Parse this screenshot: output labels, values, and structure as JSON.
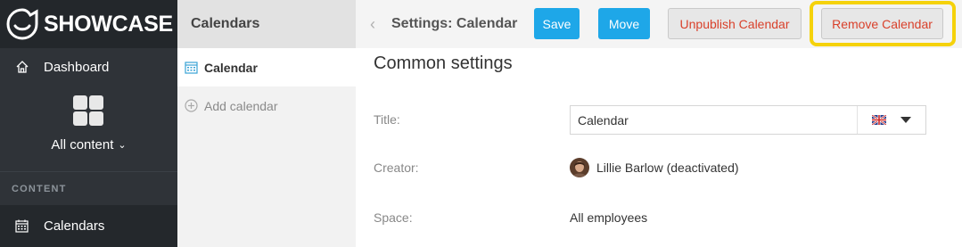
{
  "nav": {
    "brand": "SHOWCASE",
    "dashboard_label": "Dashboard",
    "all_content_label": "All content",
    "section_label": "CONTENT",
    "calendars_label": "Calendars"
  },
  "sub": {
    "header": "Calendars",
    "items": [
      {
        "label": "Calendar",
        "active": true,
        "icon": "calendar-icon"
      },
      {
        "label": "Add calendar",
        "active": false,
        "icon": "add-circle-icon"
      }
    ]
  },
  "toolbar": {
    "title": "Settings: Calendar",
    "save_label": "Save",
    "move_label": "Move",
    "unpublish_label": "Unpublish Calendar",
    "remove_label": "Remove Calendar"
  },
  "form": {
    "section_title": "Common settings",
    "title_label": "Title:",
    "title_value": "Calendar",
    "creator_label": "Creator:",
    "creator_name": "Lillie Barlow (deactivated)",
    "space_label": "Space:",
    "space_value": "All employees"
  },
  "colors": {
    "primary_button": "#1ea7e8",
    "danger_text": "#d9412b",
    "highlight": "#f5d20b",
    "nav_bg": "#2f3338"
  }
}
